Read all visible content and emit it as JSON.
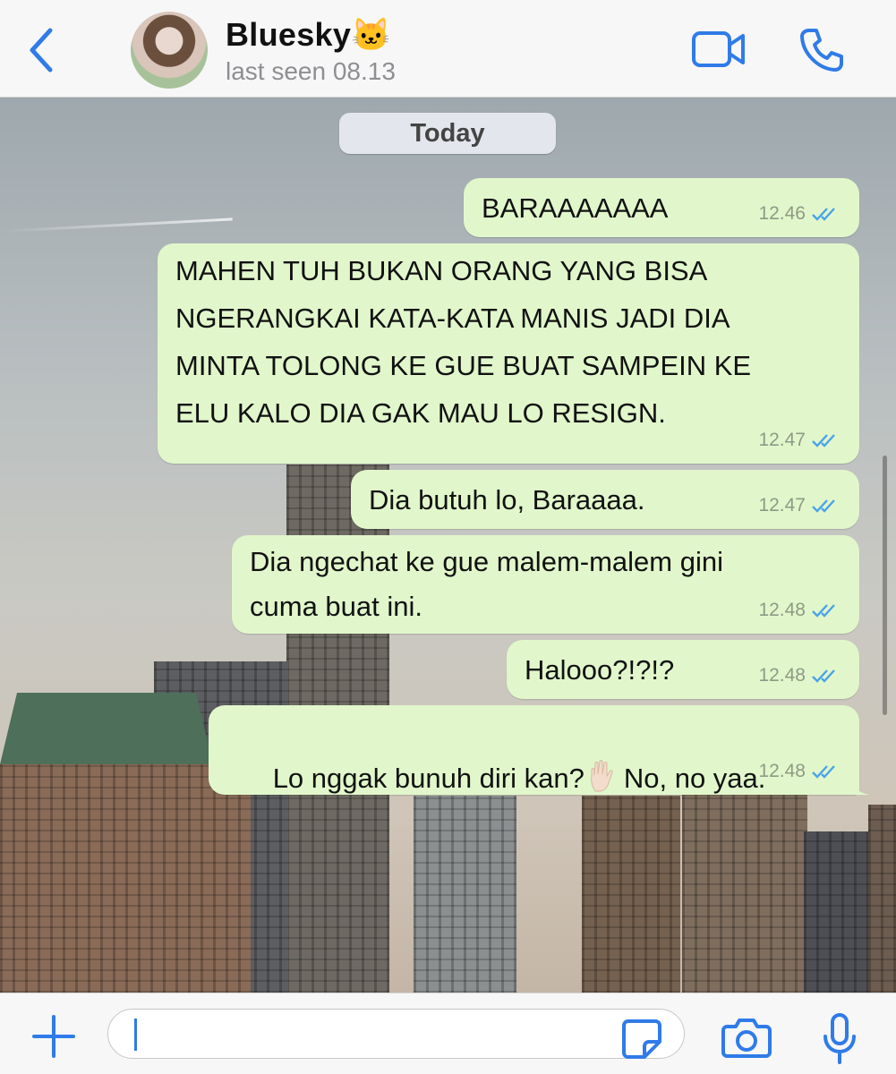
{
  "header": {
    "contact_name": "Bluesky🐱",
    "last_seen": "last seen 08.13",
    "back_icon": "chevron-left-icon",
    "video_icon": "video-camera-icon",
    "call_icon": "phone-icon",
    "accent_color": "#2f7be8"
  },
  "chat": {
    "date_label": "Today",
    "bubble_color": "#e1f7cb",
    "messages": [
      {
        "text": "BARAAAAAAA",
        "time": "12.46",
        "status": "read"
      },
      {
        "text": "MAHEN TUH BUKAN ORANG YANG BISA\nNGERANGKAI KATA-KATA MANIS JADI DIA\nMINTA TOLONG KE GUE BUAT SAMPEIN KE\nELU KALO DIA GAK MAU LO RESIGN.",
        "time": "12.47",
        "status": "read"
      },
      {
        "text": "Dia butuh lo, Baraaaa.",
        "time": "12.47",
        "status": "read"
      },
      {
        "text": "Dia ngechat ke gue malem-malem gini\ncuma buat ini.",
        "time": "12.48",
        "status": "read"
      },
      {
        "text": "Halooo?!?!?",
        "time": "12.48",
        "status": "read"
      },
      {
        "text_before": "Lo nggak bunuh diri kan?",
        "emoji": "raised-hand-icon",
        "text_after": "No, no yaa.",
        "time": "12.48",
        "status": "read"
      }
    ]
  },
  "composer": {
    "input_value": "",
    "plus_icon": "plus-icon",
    "sticker_icon": "sticker-icon",
    "camera_icon": "camera-icon",
    "mic_icon": "microphone-icon"
  }
}
